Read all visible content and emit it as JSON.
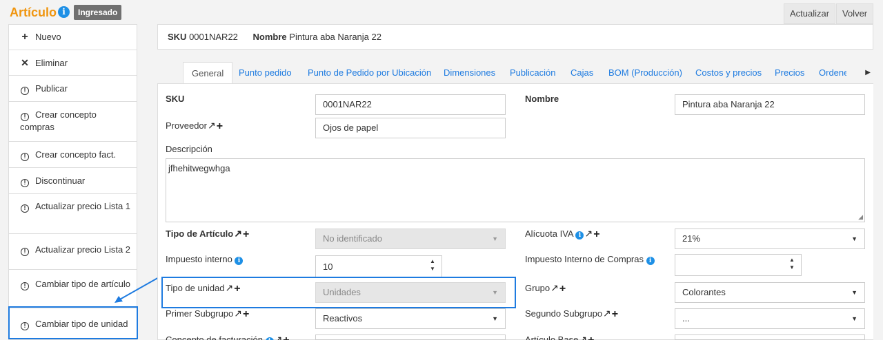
{
  "header": {
    "title": "Artículo",
    "status_badge": "Ingresado",
    "refresh_label": "Actualizar",
    "back_label": "Volver"
  },
  "sidebar": {
    "items": [
      {
        "icon": "plus-icon",
        "label": "Nuevo"
      },
      {
        "icon": "close-icon",
        "label": "Eliminar"
      },
      {
        "icon": "alert-circle-icon",
        "label": "Publicar"
      },
      {
        "icon": "alert-circle-icon",
        "label": "Crear concepto compras"
      },
      {
        "icon": "alert-circle-icon",
        "label": "Crear concepto fact."
      },
      {
        "icon": "alert-circle-icon",
        "label": "Discontinuar"
      },
      {
        "icon": "alert-circle-icon",
        "label": "Actualizar precio Lista 1"
      },
      {
        "icon": "alert-circle-icon",
        "label": "Actualizar precio Lista 2"
      },
      {
        "icon": "alert-circle-icon",
        "label": "Cambiar tipo de artículo"
      },
      {
        "icon": "alert-circle-icon",
        "label": "Cambiar tipo de unidad"
      }
    ]
  },
  "infobar": {
    "sku_label": "SKU",
    "sku_value": "0001NAR22",
    "name_label": "Nombre",
    "name_value": "Pintura aba Naranja 22"
  },
  "tabs": [
    "General",
    "Punto pedido",
    "Punto de Pedido por Ubicación",
    "Dimensiones",
    "Publicación",
    "Cajas",
    "BOM (Producción)",
    "Costos y precios",
    "Precios",
    "Ordene"
  ],
  "form": {
    "sku_label": "SKU",
    "sku_value": "0001NAR22",
    "nombre_label": "Nombre",
    "nombre_value": "Pintura aba Naranja 22",
    "proveedor_label": "Proveedor",
    "proveedor_value": "Ojos de papel",
    "descripcion_label": "Descripción",
    "descripcion_value": "jfhehitwegwhga",
    "tipo_articulo_label": "Tipo de Artículo",
    "tipo_articulo_value": "No identificado",
    "alicuota_label": "Alícuota IVA",
    "alicuota_value": "21%",
    "impuesto_interno_label": "Impuesto interno",
    "impuesto_interno_value": "10",
    "impuesto_compras_label": "Impuesto Interno de Compras",
    "impuesto_compras_value": "",
    "tipo_unidad_label": "Tipo de unidad",
    "tipo_unidad_value": "Unidades",
    "grupo_label": "Grupo",
    "grupo_value": "Colorantes",
    "primer_subgrupo_label": "Primer Subgrupo",
    "primer_subgrupo_value": "Reactivos",
    "segundo_subgrupo_label": "Segundo Subgrupo",
    "segundo_subgrupo_value": "...",
    "concepto_label": "Concepto de facturación",
    "articulo_base_label": "Artículo Base"
  },
  "colors": {
    "accent": "#f0950f",
    "link": "#1e7be0",
    "highlight": "#1e7be0"
  }
}
